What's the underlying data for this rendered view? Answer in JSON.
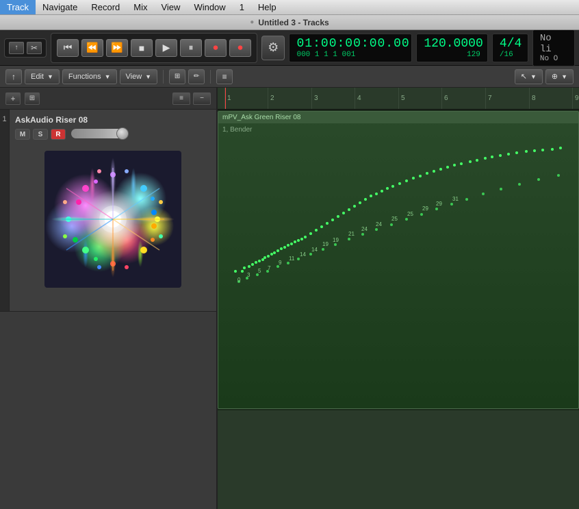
{
  "menubar": {
    "items": [
      "Track",
      "Navigate",
      "Record",
      "Mix",
      "View",
      "Window",
      "1",
      "Help"
    ]
  },
  "titlebar": {
    "icon": "●",
    "title": "Untitled 3 - Tracks"
  },
  "transport": {
    "time_main": "01:00:00:00.00",
    "time_sub": "000 1  1  1  001",
    "tempo_main": "120.0000",
    "tempo_sub": "129",
    "time_sig_main": "4/4",
    "time_sig_sub": "/16",
    "key_main": "No li",
    "key_sub": "No O"
  },
  "toolbar": {
    "edit_label": "Edit",
    "functions_label": "Functions",
    "view_label": "View"
  },
  "track": {
    "number": "1",
    "name": "AskAudio Riser 08",
    "btn_m": "M",
    "btn_s": "S",
    "btn_r": "R"
  },
  "arrangement": {
    "region_name": "mPV_Ask Green Riser 08",
    "region_label": "1, Bender",
    "ruler_marks": [
      "1",
      "2",
      "3",
      "4",
      "5",
      "6",
      "7",
      "8",
      "9"
    ]
  },
  "icons": {
    "gear": "⚙",
    "rewind": "◀◀",
    "back": "◀",
    "forward": "▶▶",
    "stop": "■",
    "play": "▶",
    "pause": "⏸",
    "record_arm": "⏺",
    "record": "⏺",
    "arrow_up": "↑",
    "arrow_down": "↓",
    "plus": "+",
    "folder_plus": "+",
    "filter": "≡",
    "collapse": "−",
    "cursor": "↖",
    "chevron": "▼",
    "bracket_open": "[",
    "pencil": "✎",
    "magnify": "⊕"
  }
}
